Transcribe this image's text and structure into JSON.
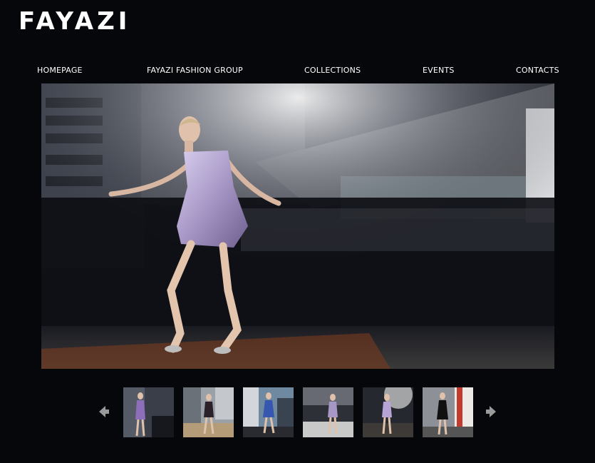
{
  "brand": {
    "logo_text": "FAYAZI"
  },
  "nav": {
    "items": [
      {
        "label": "HOMEPAGE"
      },
      {
        "label": "FAYAZI FASHION GROUP"
      },
      {
        "label": "COLLECTIONS"
      },
      {
        "label": "EVENTS"
      },
      {
        "label": "CONTACTS"
      }
    ]
  },
  "gallery": {
    "main_image": "fashion-model-photo",
    "thumbnails": [
      {
        "image": "model-lilac-dress-thumbnail"
      },
      {
        "image": "model-dark-dress-thumbnail"
      },
      {
        "image": "model-blue-dress-thumbnail"
      },
      {
        "image": "model-lilac-dress-interior-thumbnail"
      },
      {
        "image": "model-lilac-dress-sunlight-thumbnail"
      },
      {
        "image": "model-black-dress-thumbnail"
      }
    ],
    "prev_icon": "arrow-left-icon",
    "next_icon": "arrow-right-icon"
  },
  "colors": {
    "background": "#06070a",
    "text": "#ffffff",
    "arrow": "#9a9a9a"
  }
}
